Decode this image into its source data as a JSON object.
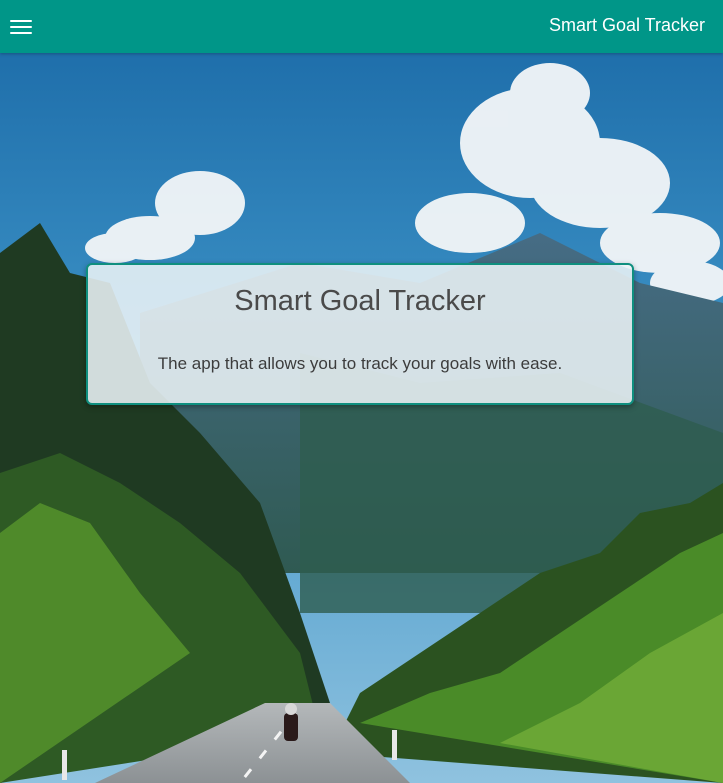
{
  "header": {
    "title": "Smart Goal Tracker",
    "menu_icon": "hamburger-menu-icon",
    "background_color": "#009688"
  },
  "hero": {
    "title": "Smart Goal Tracker",
    "subtitle": "The app that allows you to track your goals with ease.",
    "border_color": "#0f8f7f"
  },
  "background": {
    "description_icon": "mountain-forest-road-photo"
  }
}
